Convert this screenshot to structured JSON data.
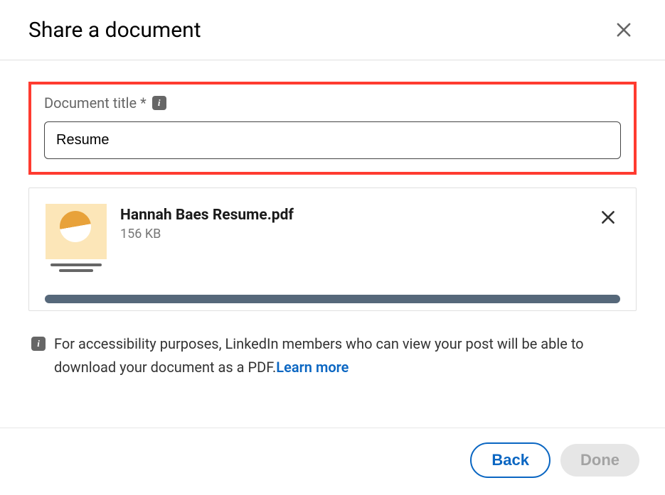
{
  "header": {
    "title": "Share a document"
  },
  "form": {
    "title_label": "Document title  *",
    "title_value": "Resume"
  },
  "file": {
    "name": "Hannah Baes Resume.pdf",
    "size": "156 KB"
  },
  "note": {
    "text": "For accessibility purposes, LinkedIn members who can view your post will be able to download your document as a PDF.",
    "learn_more": "Learn more"
  },
  "footer": {
    "back": "Back",
    "done": "Done"
  }
}
